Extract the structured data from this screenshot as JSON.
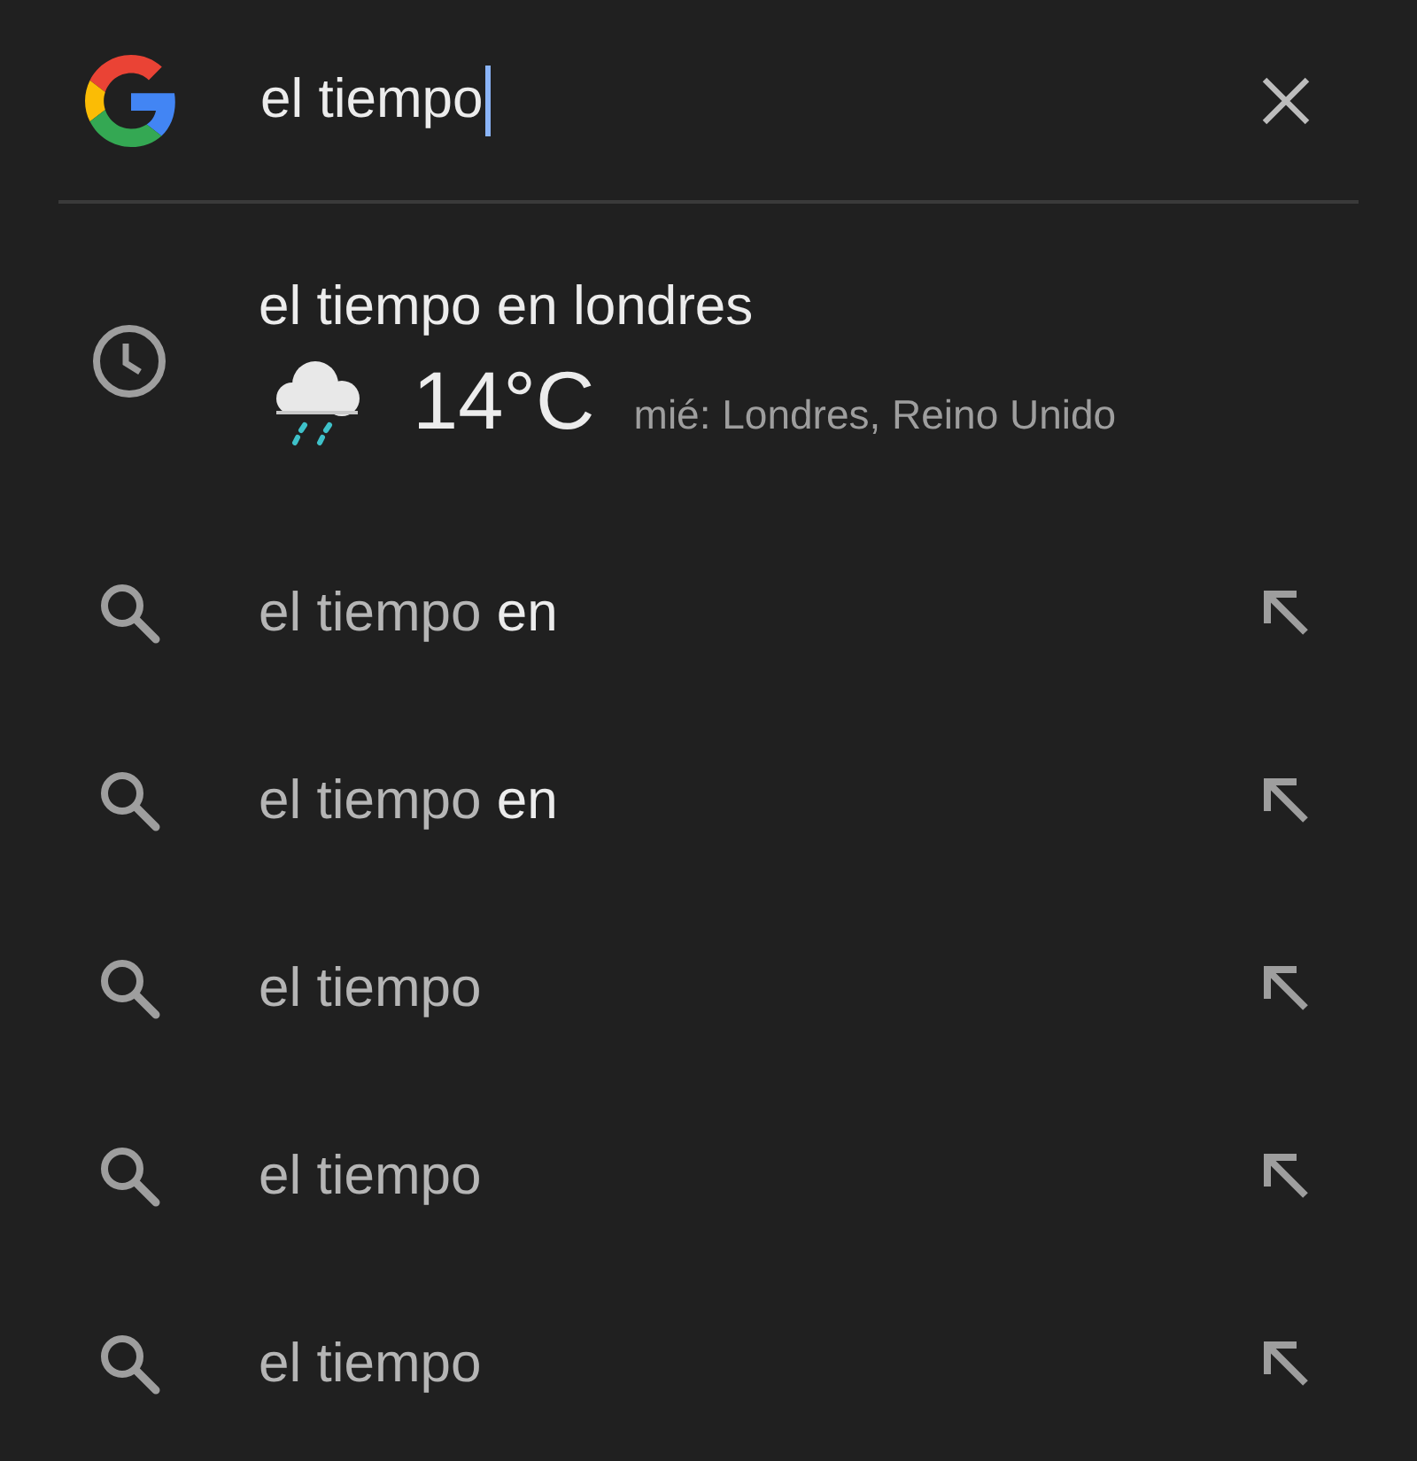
{
  "search": {
    "value": "el tiempo",
    "focused": true
  },
  "history_item": {
    "title": "el tiempo en londres",
    "weather": {
      "temperature": "14°C",
      "detail": "mié: Londres, Reino Unido"
    }
  },
  "suggestions": [
    {
      "query": "el tiempo",
      "completion": "en"
    },
    {
      "query": "el tiempo",
      "completion": "en"
    },
    {
      "query": "el tiempo"
    },
    {
      "query": "el tiempo"
    },
    {
      "query": "el tiempo"
    }
  ]
}
